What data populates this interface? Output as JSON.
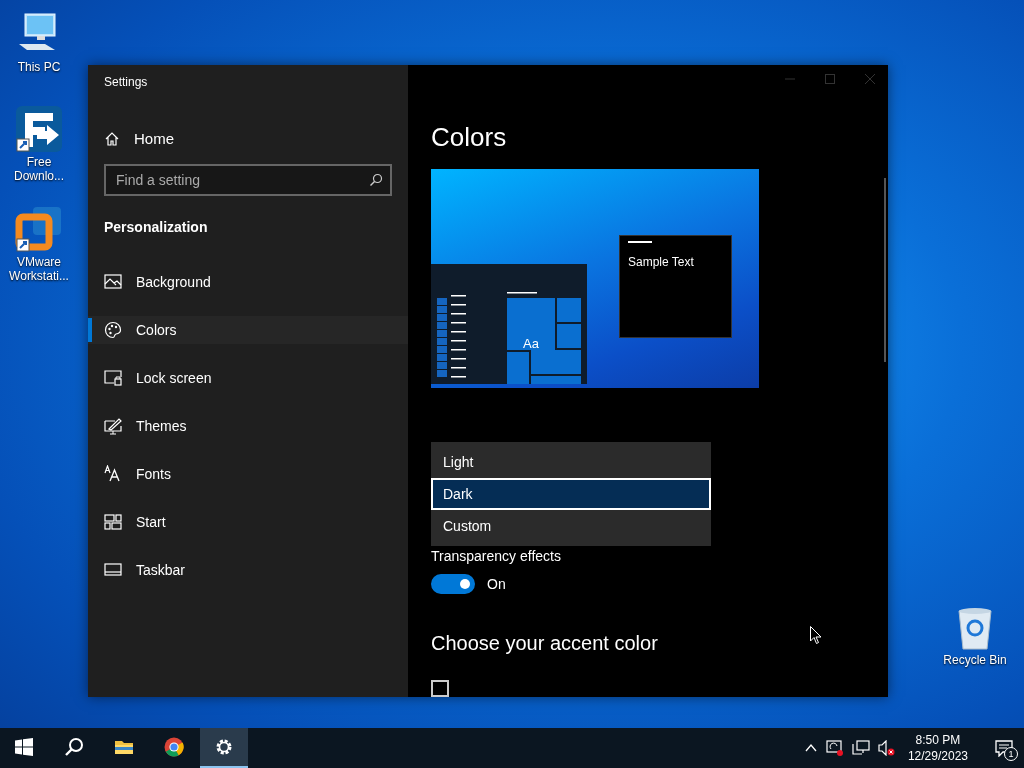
{
  "desktop_icons": [
    {
      "kind": "pc",
      "lines": [
        "This PC"
      ]
    },
    {
      "kind": "download",
      "lines": [
        "Free",
        "Downlo..."
      ]
    },
    {
      "kind": "vmware",
      "lines": [
        "VMware",
        "Workstati..."
      ]
    },
    {
      "kind": "bin",
      "lines": [
        "Recycle Bin"
      ]
    }
  ],
  "window": {
    "title": "Settings",
    "sidebar": {
      "home": "Home",
      "search_placeholder": "Find a setting",
      "section": "Personalization",
      "items": [
        {
          "kind": "picture",
          "label": "Background",
          "selected": false
        },
        {
          "kind": "palette",
          "label": "Colors",
          "selected": true
        },
        {
          "kind": "lock",
          "label": "Lock screen",
          "selected": false
        },
        {
          "kind": "brush",
          "label": "Themes",
          "selected": false
        },
        {
          "kind": "fonts",
          "label": "Fonts",
          "selected": false
        },
        {
          "kind": "start",
          "label": "Start",
          "selected": false
        },
        {
          "kind": "taskbar",
          "label": "Taskbar",
          "selected": false
        }
      ]
    },
    "content": {
      "heading": "Colors",
      "preview": {
        "tile_label": "Aa",
        "sample_text": "Sample Text"
      },
      "dropdown_options": [
        {
          "label": "Light",
          "selected": false
        },
        {
          "label": "Dark",
          "selected": true
        },
        {
          "label": "Custom",
          "selected": false
        }
      ],
      "transparency": {
        "label": "Transparency effects",
        "on": true,
        "state_text": "On"
      },
      "accent_heading": "Choose your accent color",
      "auto_accent": {
        "checked": false
      }
    }
  },
  "taskbar": {
    "apps": [
      {
        "kind": "start",
        "selected": false
      },
      {
        "kind": "search",
        "selected": false
      },
      {
        "kind": "folder",
        "selected": false
      },
      {
        "kind": "chrome",
        "selected": false
      },
      {
        "kind": "settings",
        "selected": true
      }
    ],
    "clock": {
      "time": "8:50 PM",
      "date": "12/29/2023"
    },
    "notification_count": "1"
  }
}
